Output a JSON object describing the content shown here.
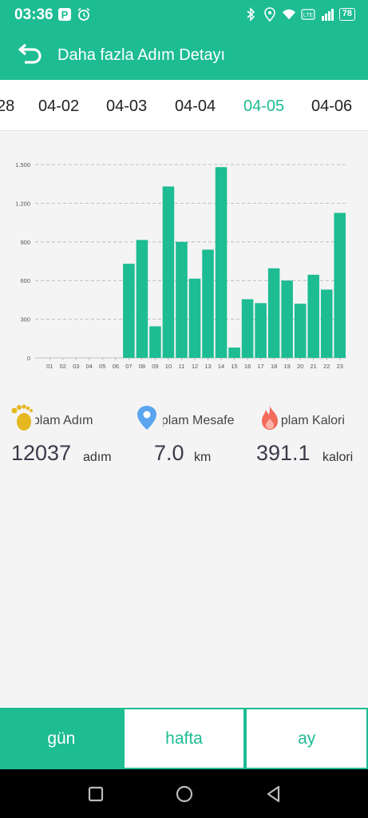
{
  "status_bar": {
    "time": "03:36",
    "battery": "78",
    "icons": [
      "paypal-icon",
      "alarm-icon",
      "bluetooth-icon",
      "location-icon",
      "wifi-icon",
      "volte-icon",
      "signal-icon",
      "battery-icon"
    ]
  },
  "app_bar": {
    "title": "Daha fazla Adım Detayı",
    "back_icon": "back-arrow-icon"
  },
  "date_tabs": [
    {
      "label": "28",
      "active": false
    },
    {
      "label": "04-02",
      "active": false
    },
    {
      "label": "04-03",
      "active": false
    },
    {
      "label": "04-04",
      "active": false
    },
    {
      "label": "04-05",
      "active": true
    },
    {
      "label": "04-06",
      "active": false
    }
  ],
  "chart_data": {
    "type": "bar",
    "categories": [
      "01",
      "02",
      "03",
      "04",
      "05",
      "06",
      "07",
      "08",
      "09",
      "10",
      "11",
      "12",
      "13",
      "14",
      "15",
      "16",
      "17",
      "18",
      "19",
      "20",
      "21",
      "22",
      "23"
    ],
    "values": [
      0,
      0,
      0,
      0,
      0,
      0,
      730,
      915,
      245,
      1330,
      900,
      615,
      840,
      1480,
      80,
      455,
      425,
      695,
      600,
      420,
      645,
      530,
      1125
    ],
    "y_ticks": [
      "0",
      "300",
      "600",
      "900",
      "1.200",
      "1.500"
    ],
    "ylim": [
      0,
      1500
    ],
    "grid": true,
    "bar_color": "#1dbc93"
  },
  "stats": [
    {
      "label": "Toplam Adım",
      "value": "12037",
      "unit": "adım",
      "icon": "footprint-icon"
    },
    {
      "label": "Toplam Mesafe",
      "value": "7.0",
      "unit": "km",
      "icon": "location-pin-icon"
    },
    {
      "label": "Toplam Kalori",
      "value": "391.1",
      "unit": "kalori",
      "icon": "flame-icon"
    }
  ],
  "bottom_tabs": [
    {
      "label": "gün",
      "active": true
    },
    {
      "label": "hafta",
      "active": false
    },
    {
      "label": "ay",
      "active": false
    }
  ],
  "colors": {
    "accent": "#1dbc93",
    "background": "#f4f4f4"
  }
}
